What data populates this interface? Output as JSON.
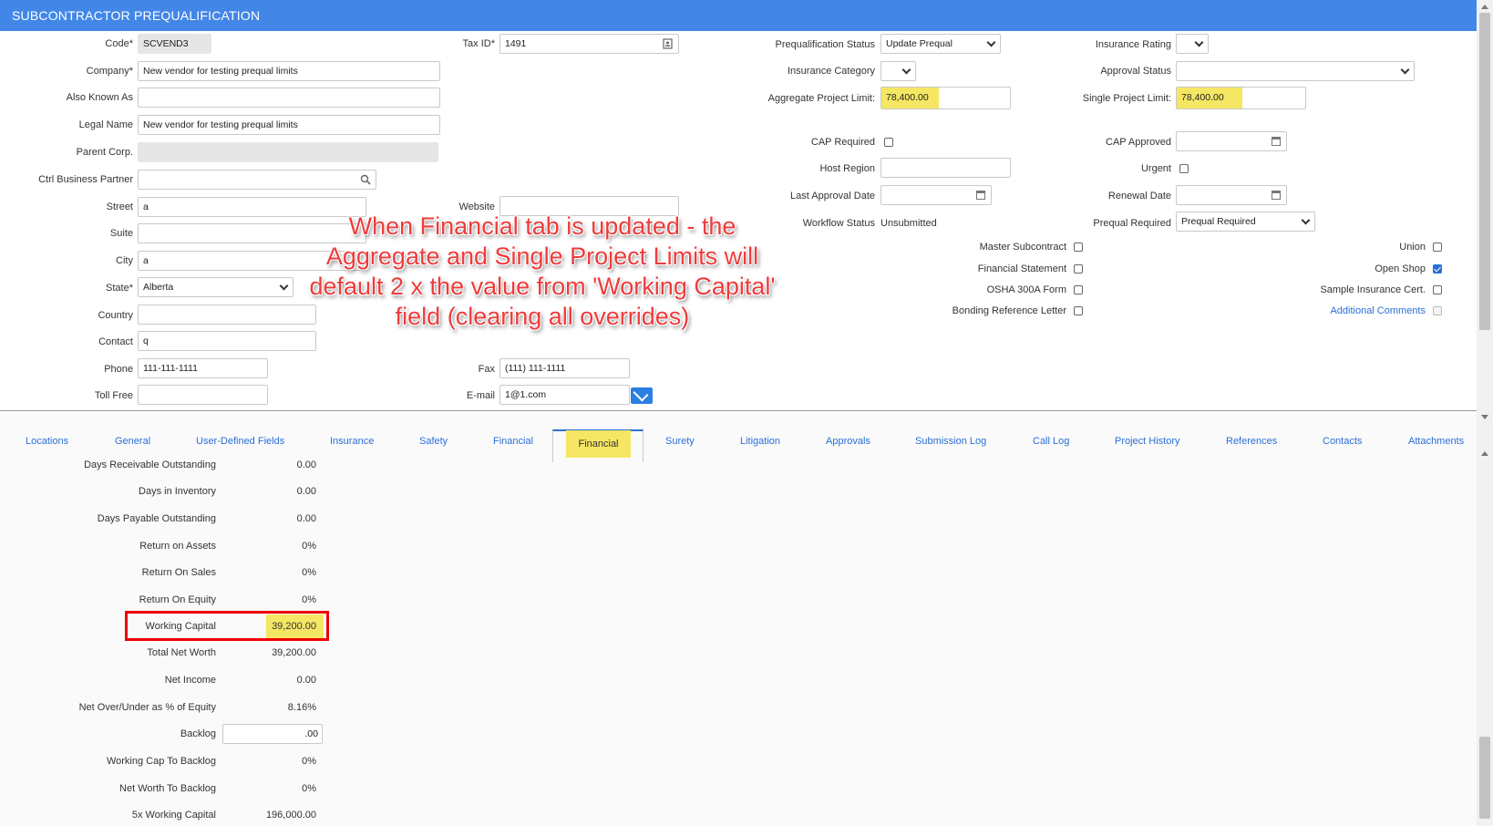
{
  "title": "SUBCONTRACTOR PREQUALIFICATION",
  "left": {
    "code_label": "Code*",
    "code_value": "SCVEND3",
    "company_label": "Company*",
    "company_value": "New vendor for testing prequal limits",
    "aka_label": "Also Known As",
    "aka_value": "",
    "legal_label": "Legal Name",
    "legal_value": "New vendor for testing prequal limits",
    "parent_label": "Parent Corp.",
    "ctrl_label": "Ctrl Business Partner",
    "street_label": "Street",
    "street_value": "a",
    "suite_label": "Suite",
    "city_label": "City",
    "city_value": "a",
    "state_label": "State*",
    "state_value": "Alberta",
    "country_label": "Country",
    "contact_label": "Contact",
    "contact_value": "q",
    "phone_label": "Phone",
    "phone_value": "111-111-1111",
    "tollfree_label": "Toll Free"
  },
  "middle": {
    "taxid_label": "Tax ID*",
    "taxid_value": "1491",
    "website_label": "Website",
    "fax_label": "Fax",
    "fax_value": "(111) 111-1111",
    "email_label": "E-mail",
    "email_value": "1@1.com"
  },
  "right": {
    "prequal_status_label": "Prequalification Status",
    "prequal_status_value": "Update Prequal",
    "ins_category_label": "Insurance Category",
    "agg_limit_label": "Aggregate Project Limit:",
    "agg_limit_value": "78,400.00",
    "cap_required_label": "CAP Required",
    "host_region_label": "Host Region",
    "last_approval_label": "Last Approval Date",
    "workflow_label": "Workflow Status",
    "workflow_value": "Unsubmitted",
    "ins_rating_label": "Insurance Rating",
    "approval_status_label": "Approval Status",
    "single_limit_label": "Single Project Limit:",
    "single_limit_value": "78,400.00",
    "cap_approved_label": "CAP Approved",
    "urgent_label": "Urgent",
    "renewal_label": "Renewal Date",
    "prequal_required_label": "Prequal Required",
    "prequal_required_value": "Prequal Required",
    "master_sub_label": "Master Subcontract",
    "fin_statement_label": "Financial Statement",
    "osha_label": "OSHA 300A Form",
    "bonding_label": "Bonding Reference Letter",
    "union_label": "Union",
    "open_shop_label": "Open Shop",
    "sample_ins_label": "Sample Insurance Cert.",
    "add_comments_label": "Additional Comments"
  },
  "annotation": "When Financial tab is updated - the Aggregate and Single Project Limits will default 2 x the value from 'Working Capital' field (clearing all overrides)",
  "tabs": [
    "Locations",
    "General",
    "User-Defined Fields",
    "Insurance",
    "Safety",
    "Financial",
    "Financial",
    "Surety",
    "Litigation",
    "Approvals",
    "Submission Log",
    "Call Log",
    "Project History",
    "References",
    "Contacts",
    "Attachments"
  ],
  "financial": [
    {
      "label": "Days Receivable Outstanding",
      "value": "0.00"
    },
    {
      "label": "Days in Inventory",
      "value": "0.00"
    },
    {
      "label": "Days Payable Outstanding",
      "value": "0.00"
    },
    {
      "label": "Return on Assets",
      "value": "0%"
    },
    {
      "label": "Return On Sales",
      "value": "0%"
    },
    {
      "label": "Return On Equity",
      "value": "0%"
    },
    {
      "label": "Working Capital",
      "value": "39,200.00"
    },
    {
      "label": "Total Net Worth",
      "value": "39,200.00"
    },
    {
      "label": "Net Income",
      "value": "0.00"
    },
    {
      "label": "Net Over/Under as % of Equity",
      "value": "8.16%"
    },
    {
      "label": "Backlog",
      "value": ".00"
    },
    {
      "label": "Working Cap To Backlog",
      "value": "0%"
    },
    {
      "label": "Net Worth To Backlog",
      "value": "0%"
    },
    {
      "label": "5x Working Capital",
      "value": "196,000.00"
    }
  ],
  "colors": {
    "title_bar": "#4287e8",
    "highlight": "#f5e663",
    "annotation": "#ee3b3b",
    "link": "#2a6fd6"
  }
}
